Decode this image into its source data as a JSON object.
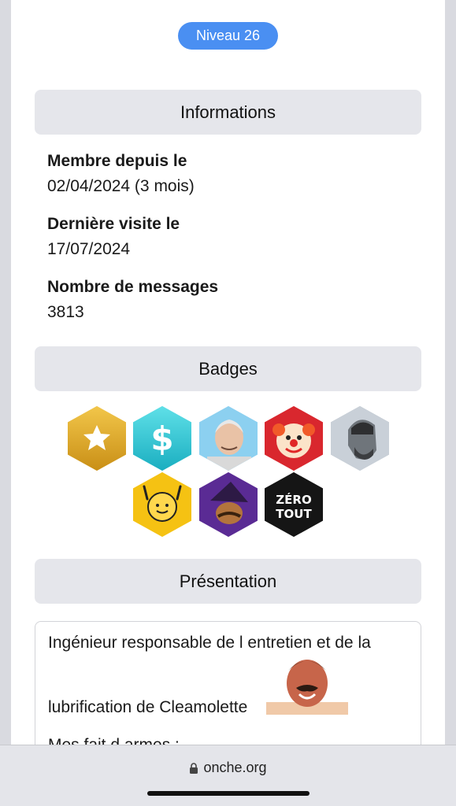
{
  "profile": {
    "level_label": "Niveau 26"
  },
  "sections": {
    "informations": "Informations",
    "badges": "Badges",
    "presentation": "Présentation"
  },
  "info": {
    "member_since_label": "Membre depuis le",
    "member_since_value": "02/04/2024 (3 mois)",
    "last_visit_label": "Dernière visite le",
    "last_visit_value": "17/07/2024",
    "messages_label": "Nombre de messages",
    "messages_value": "3813"
  },
  "badges": [
    {
      "name": "star-badge",
      "color": "#e0ad2a"
    },
    {
      "name": "dollar-badge",
      "color": "#29c9d6"
    },
    {
      "name": "hide-the-pain-harold-badge",
      "color": "#7cc6ec"
    },
    {
      "name": "clown-badge",
      "color": "#d9272e"
    },
    {
      "name": "gigachad-badge",
      "color": "#8e9aa7"
    },
    {
      "name": "happy-face-badge",
      "color": "#f5c213"
    },
    {
      "name": "wizard-badge",
      "color": "#6a35a6"
    },
    {
      "name": "zero-tout-badge",
      "color": "#151515",
      "text_top": "ZÉRO",
      "text_bottom": "TOUT"
    }
  ],
  "presentation": {
    "line1": "Ingénieur responsable de l entretien et de la",
    "line2": "lubrification de Cleamolette",
    "line3": "Mes fait d armes :"
  },
  "browser": {
    "url": "onche.org"
  }
}
